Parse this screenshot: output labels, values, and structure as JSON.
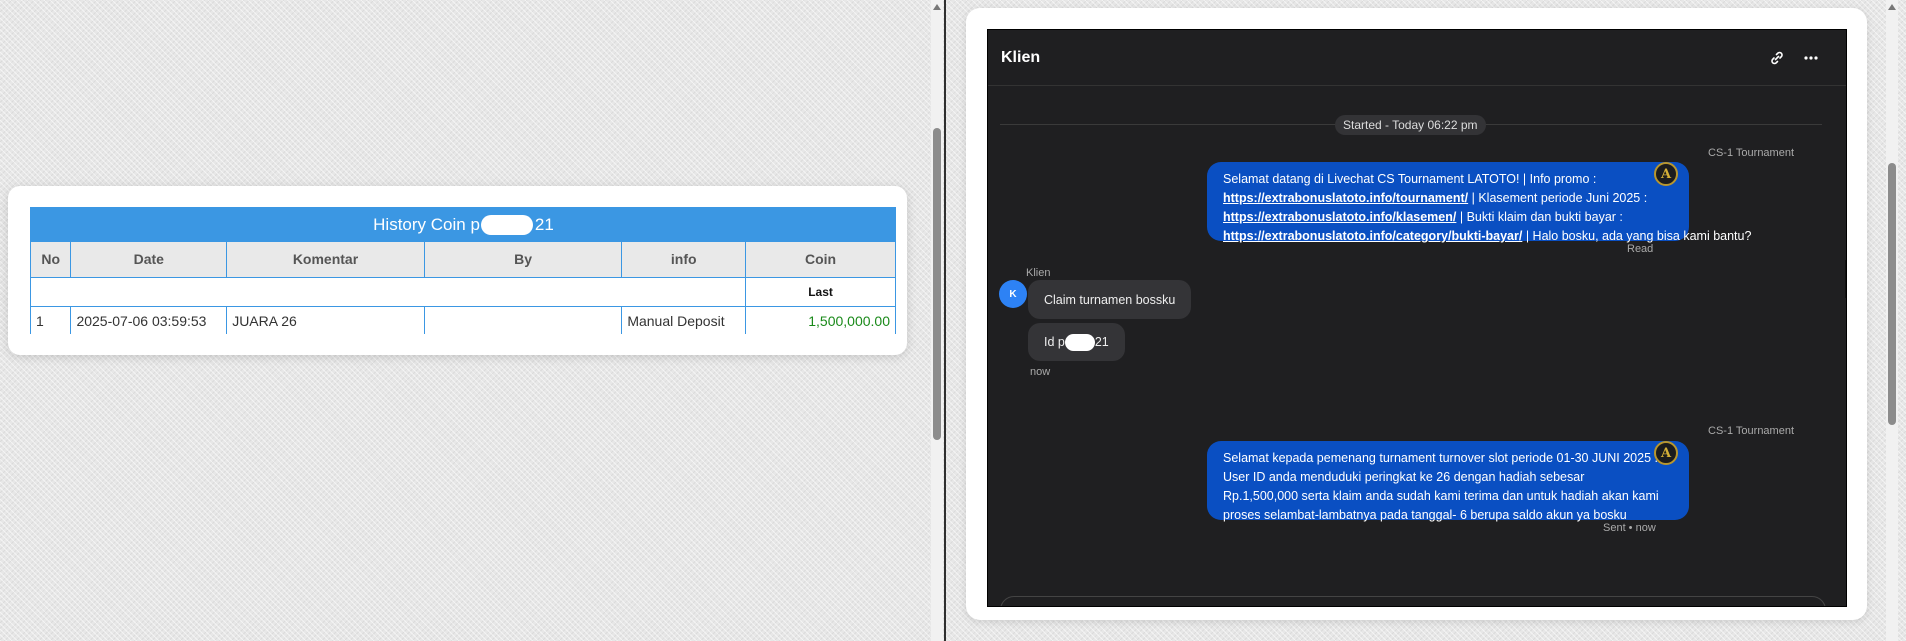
{
  "history": {
    "title_prefix": "History Coin p",
    "title_suffix": "21",
    "columns": [
      "No",
      "Date",
      "Komentar",
      "By",
      "info",
      "Coin"
    ],
    "last_label": "Last",
    "rows": [
      {
        "no": "1",
        "date": "2025-07-06 03:59:53",
        "komentar": "JUARA 26",
        "by": "",
        "info": "Manual Deposit",
        "coin": "1,500,000.00"
      }
    ]
  },
  "chat": {
    "title": "Klien",
    "started": "Started - Today 06:22 pm",
    "messages": {
      "agent1": {
        "sender": "CS-1 Tournament",
        "line1": "Selamat datang di Livechat CS Tournament LATOTO! | Info promo :",
        "link1": "https://extrabonuslatoto.info/tournament/",
        "text2": " | Klasement periode Juni 2025 :",
        "link2": "https://extrabonuslatoto.info/klasemen/",
        "text3": " | Bukti klaim dan bukti bayar :",
        "link3": "https://extrabonuslatoto.info/category/bukti-bayar/",
        "text4": " | Halo bosku, ada yang bisa kami bantu?",
        "status": "Read"
      },
      "client": {
        "sender": "Klien",
        "avatar": "K",
        "msg1": "Claim turnamen bossku",
        "msg2_prefix": "Id p",
        "msg2_suffix": "21",
        "time": "now"
      },
      "agent2": {
        "sender": "CS-1 Tournament",
        "text": "Selamat kepada pemenang turnament turnover slot periode 01-30 JUNI 2025 . User ID anda menduduki peringkat ke 26 dengan hadiah sebesar Rp.1,500,000 serta klaim anda sudah kami terima dan untuk hadiah akan kami proses selambat-lambatnya pada tanggal- 6 berupa saldo akun ya bosku",
        "status": "Sent • now"
      }
    },
    "agent_avatar": "A",
    "icons": [
      "link-icon",
      "more-horizontal-icon"
    ]
  },
  "colors": {
    "table_header": "#3b97e3",
    "agent_bubble": "#0a4fc2",
    "coin_green": "#1a8a1a",
    "chat_bg": "#1f1f21"
  }
}
